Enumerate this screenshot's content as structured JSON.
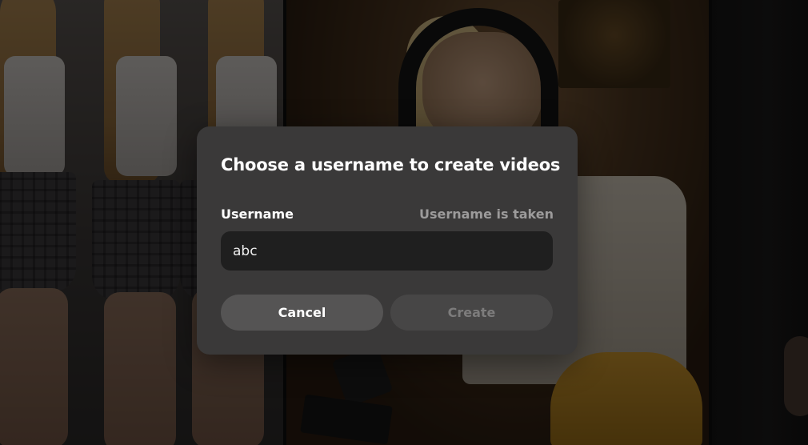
{
  "dialog": {
    "title": "Choose a username to create videos",
    "username_label": "Username",
    "username_status": "Username is taken",
    "username_value": "abc",
    "cancel_label": "Cancel",
    "create_label": "Create",
    "create_enabled": false
  },
  "colors": {
    "dialog_bg": "#3a3939",
    "input_bg": "#1f1f1f",
    "cancel_bg": "#555454",
    "create_bg_disabled": "#474646",
    "status_text": "#9c9b9b"
  }
}
